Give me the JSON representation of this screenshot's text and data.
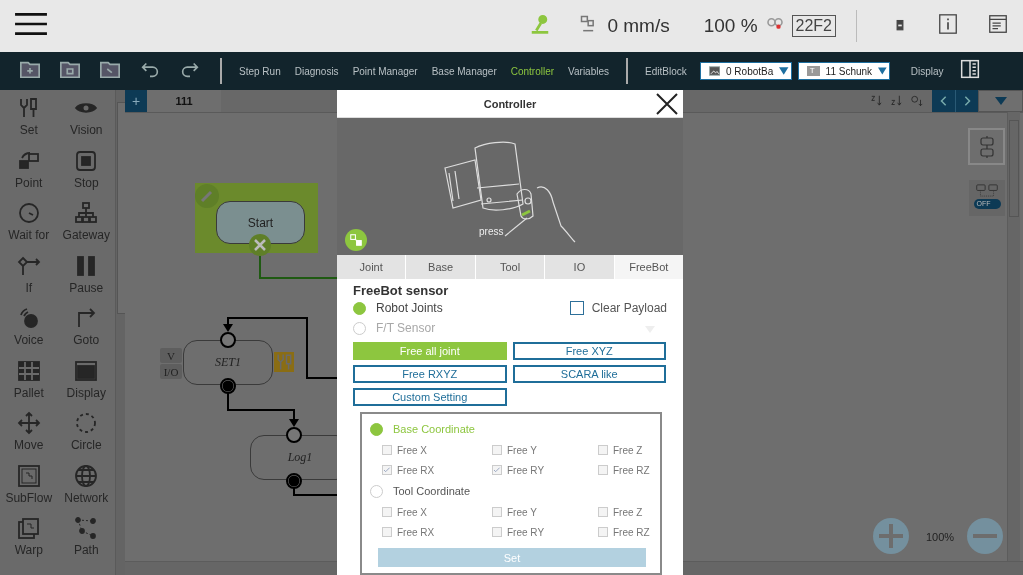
{
  "status_bar": {
    "speed": "0 mm/s",
    "percent": "100 %",
    "code": "22F2"
  },
  "toolbar": {
    "items": [
      {
        "label": "Step Run",
        "selected": false
      },
      {
        "label": "Diagnosis",
        "selected": false
      },
      {
        "label": "Point Manager",
        "selected": false
      },
      {
        "label": "Base Manager",
        "selected": false
      },
      {
        "label": "Controller",
        "selected": true
      },
      {
        "label": "Variables",
        "selected": false
      }
    ],
    "edit_block": "EditBlock",
    "base_select": "0 RobotBa",
    "tool_badge": "T",
    "tool_select": "11 Schunk",
    "display": "Display"
  },
  "palette": [
    {
      "label": "Set"
    },
    {
      "label": "Vision"
    },
    {
      "label": "Point"
    },
    {
      "label": "Stop"
    },
    {
      "label": "Wait for"
    },
    {
      "label": "Gateway"
    },
    {
      "label": "If"
    },
    {
      "label": "Pause"
    },
    {
      "label": "Voice"
    },
    {
      "label": "Goto"
    },
    {
      "label": "Pallet"
    },
    {
      "label": "Display"
    },
    {
      "label": "Move"
    },
    {
      "label": "Circle"
    },
    {
      "label": "SubFlow"
    },
    {
      "label": "Network"
    },
    {
      "label": "Warp"
    },
    {
      "label": "Path"
    }
  ],
  "flow_tab": {
    "add": "+",
    "title": "111"
  },
  "flow_nodes": [
    {
      "kind": "start",
      "label": "Start"
    },
    {
      "kind": "set",
      "label": "SET1",
      "tags": [
        "V",
        "I/O"
      ]
    },
    {
      "kind": "log",
      "label": "Log1"
    }
  ],
  "auto_align": {
    "toggle_label": "OFF",
    "on": false
  },
  "zoom": "100%",
  "dialog": {
    "title": "Controller",
    "image_caption": "press",
    "tabs": [
      {
        "label": "Joint",
        "selected": false
      },
      {
        "label": "Base",
        "selected": false
      },
      {
        "label": "Tool",
        "selected": false
      },
      {
        "label": "IO",
        "selected": false
      },
      {
        "label": "FreeBot",
        "selected": true
      }
    ],
    "sensor_title": "FreeBot sensor",
    "sensors": [
      {
        "label": "Robot Joints",
        "selected": true,
        "disabled": false
      },
      {
        "label": "F/T Sensor",
        "selected": false,
        "disabled": true
      }
    ],
    "clear_payload": {
      "label": "Clear Payload",
      "checked": false
    },
    "modes": [
      {
        "label": "Free all joint",
        "selected": true
      },
      {
        "label": "Free XYZ",
        "selected": false
      },
      {
        "label": "Free RXYZ",
        "selected": false
      },
      {
        "label": "SCARA like",
        "selected": false
      },
      {
        "label": "Custom Setting",
        "selected": false
      }
    ],
    "coordinates": [
      {
        "label": "Base Coordinate",
        "selected": true,
        "axes": [
          {
            "label": "Free X",
            "checked": false
          },
          {
            "label": "Free Y",
            "checked": false
          },
          {
            "label": "Free Z",
            "checked": false
          },
          {
            "label": "Free RX",
            "checked": true
          },
          {
            "label": "Free RY",
            "checked": true
          },
          {
            "label": "Free RZ",
            "checked": false
          }
        ]
      },
      {
        "label": "Tool Coordinate",
        "selected": false,
        "axes": [
          {
            "label": "Free X",
            "checked": false
          },
          {
            "label": "Free Y",
            "checked": false
          },
          {
            "label": "Free Z",
            "checked": false
          },
          {
            "label": "Free RX",
            "checked": false
          },
          {
            "label": "Free RY",
            "checked": false
          },
          {
            "label": "Free RZ",
            "checked": false
          }
        ]
      }
    ],
    "set_button": "Set"
  }
}
